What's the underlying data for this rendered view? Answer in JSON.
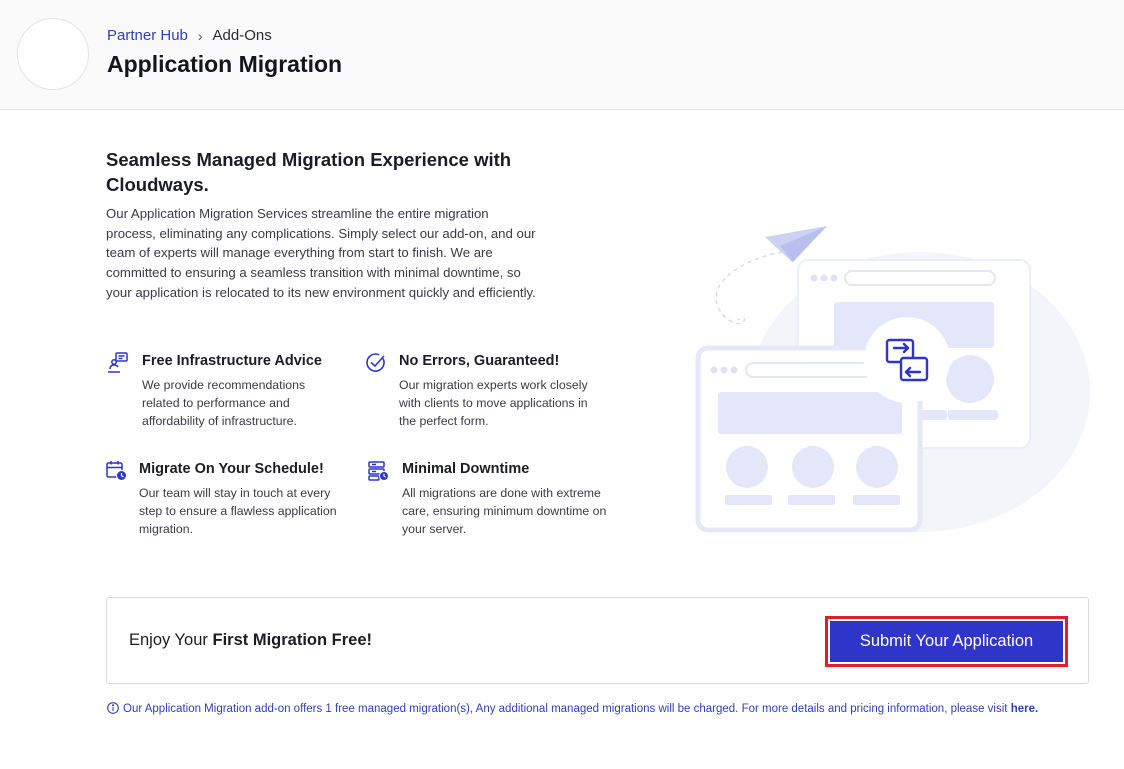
{
  "header": {
    "breadcrumb": {
      "parent": "Partner Hub",
      "separator": "›",
      "current": "Add-Ons"
    },
    "title": "Application Migration"
  },
  "intro": {
    "heading": "Seamless Managed Migration Experience with Cloudways.",
    "body": "Our Application Migration Services streamline the entire migration process, eliminating any complications. Simply select our add-on, and our team of experts will manage everything from start to finish. We are committed to ensuring a seamless transition with minimal downtime, so your application is relocated to its new environment quickly and efficiently."
  },
  "features": [
    {
      "icon": "infrastructure-advice-icon",
      "title": "Free Infrastructure Advice",
      "description": "We provide recommendations related to performance and affordability of infrastructure."
    },
    {
      "icon": "check-circle-icon",
      "title": "No Errors, Guaranteed!",
      "description": "Our migration experts work closely with clients to move applications in the perfect form."
    },
    {
      "icon": "calendar-clock-icon",
      "title": "Migrate On Your Schedule!",
      "description": "Our team will stay in touch at every step to ensure a flawless application migration."
    },
    {
      "icon": "server-clock-icon",
      "title": "Minimal Downtime",
      "description": "All migrations are done with extreme care, ensuring minimum downtime on your server."
    }
  ],
  "promo": {
    "text_prefix": "Enjoy Your ",
    "text_bold": "First Migration Free!",
    "button_label": "Submit Your Application"
  },
  "note": {
    "text": "Our Application Migration add-on offers 1 free managed migration(s), Any additional managed migrations will be charged. For more details and pricing information, please visit",
    "link_label": "here."
  },
  "colors": {
    "accent": "#2e35c8",
    "link": "#2f3fbd",
    "highlight_border": "#e41b2a"
  }
}
